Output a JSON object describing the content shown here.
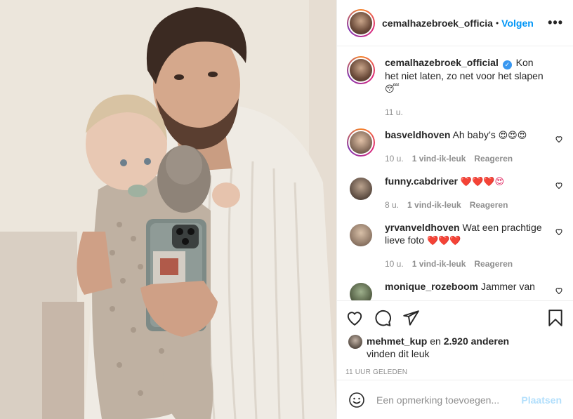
{
  "header": {
    "username": "cemalhazebroek_officia",
    "dot": "•",
    "follow_label": "Volgen",
    "more_label": "•••"
  },
  "caption": {
    "username": "cemalhazebroek_official",
    "text": "Kon het niet laten, zo net voor het slapen",
    "emoji": "😴",
    "time": "11 u."
  },
  "comments": [
    {
      "username": "basveldhoven",
      "text": "Ah baby’s",
      "emoji": "😍😍😍",
      "time": "10 u.",
      "likes": "1 vind-ik-leuk",
      "reply": "Reageren"
    },
    {
      "username": "funny.cabdriver",
      "text": "",
      "emoji": "❤️❤️❤️😍",
      "time": "8 u.",
      "likes": "1 vind-ik-leuk",
      "reply": "Reageren"
    },
    {
      "username": "yrvanveldhoven",
      "text": "Wat een prachtige lieve foto",
      "emoji": "❤️❤️❤️",
      "time": "10 u.",
      "likes": "1 vind-ik-leuk",
      "reply": "Reageren"
    },
    {
      "username": "monique_rozeboom",
      "text": "Jammer van",
      "emoji": "",
      "time": "",
      "likes": "",
      "reply": ""
    }
  ],
  "actions": {
    "like_icon": "heart-icon",
    "comment_icon": "comment-icon",
    "share_icon": "share-icon",
    "save_icon": "bookmark-icon"
  },
  "likes": {
    "user": "mehmet_kup",
    "connector": "en",
    "others": "2.920 anderen",
    "suffix": "vinden dit leuk"
  },
  "posted_ago": "11 UUR GELEDEN",
  "add_comment": {
    "placeholder": "Een opmerking toevoegen...",
    "post_label": "Plaatsen"
  },
  "colors": {
    "accent": "#0095f6",
    "muted": "#8e8e8e",
    "post_disabled": "#b2dffc"
  }
}
